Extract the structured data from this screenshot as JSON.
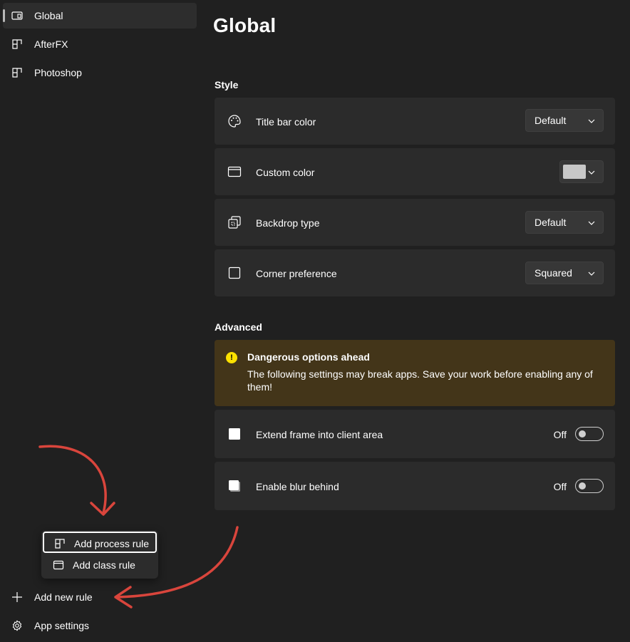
{
  "nav": {
    "items": [
      {
        "label": "Global",
        "icon": "window-icon",
        "active": true
      },
      {
        "label": "AfterFX",
        "icon": "process-rule-icon"
      },
      {
        "label": "Photoshop",
        "icon": "process-rule-icon"
      }
    ],
    "add_new_rule": "Add new rule",
    "app_settings": "App settings"
  },
  "page": {
    "title": "Global"
  },
  "style": {
    "heading": "Style",
    "title_bar_color": {
      "label": "Title bar color",
      "value": "Default",
      "icon": "palette-icon"
    },
    "custom_color": {
      "label": "Custom color",
      "swatch": "#c8c8c8",
      "icon": "window-frame-icon"
    },
    "backdrop_type": {
      "label": "Backdrop type",
      "value": "Default",
      "icon": "backdrop-icon"
    },
    "corner_preference": {
      "label": "Corner preference",
      "value": "Squared",
      "icon": "square-icon"
    }
  },
  "advanced": {
    "heading": "Advanced",
    "warning": {
      "title": "Dangerous options ahead",
      "message": "The following settings may break apps. Save your work before enabling any of them!",
      "color": "#fce100"
    },
    "extend_frame": {
      "label": "Extend frame into client area",
      "state": "Off",
      "on": false
    },
    "enable_blur": {
      "label": "Enable blur behind",
      "state": "Off",
      "on": false
    }
  },
  "add_menu": {
    "items": [
      {
        "label": "Add process rule",
        "icon": "process-rule-icon",
        "focused": true
      },
      {
        "label": "Add class rule",
        "icon": "class-rule-icon"
      }
    ]
  },
  "colors": {
    "background": "#202020",
    "card": "#2b2b2b",
    "warning_bg": "#433519",
    "annotation_arrow": "#d9453c"
  }
}
